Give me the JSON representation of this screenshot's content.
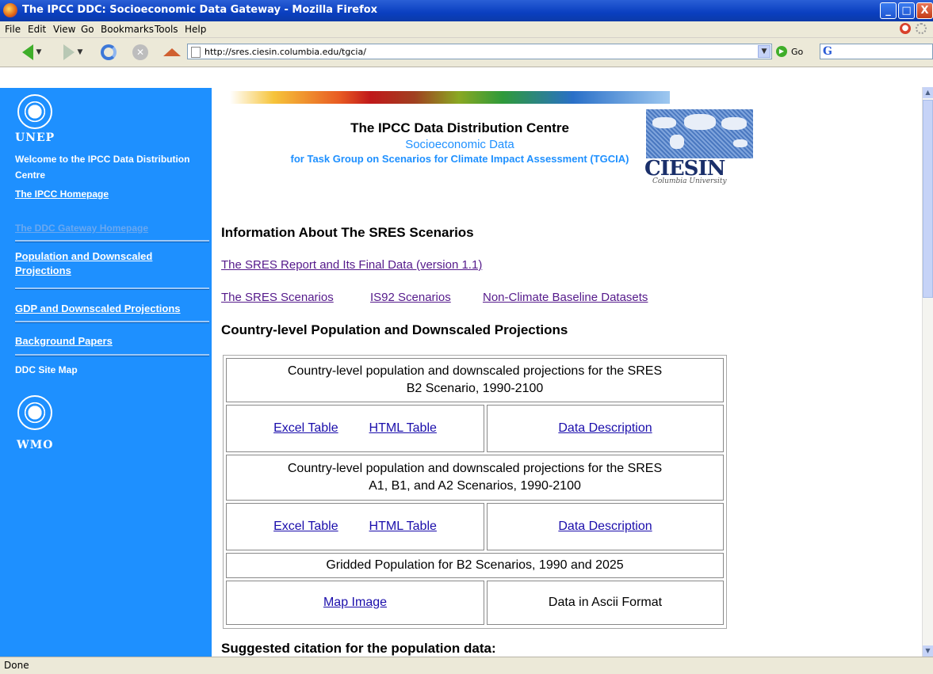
{
  "window": {
    "title": "The IPCC DDC: Socioeconomic Data Gateway - Mozilla Firefox",
    "minimize": "_",
    "maximize": "□",
    "close": "X"
  },
  "menu": [
    "File",
    "Edit",
    "View",
    "Go",
    "Bookmarks",
    "Tools",
    "Help"
  ],
  "toolbar": {
    "url": "http://sres.ciesin.columbia.edu/tgcia/",
    "go_label": "Go",
    "search_icon_letter": "G"
  },
  "sidebar": {
    "unep_label": "UNEP",
    "welcome_line1": "Welcome to the IPCC Data Distribution",
    "welcome_line2": "Centre",
    "ipcc_home": "The IPCC Homepage",
    "ddc_home": "The DDC Gateway Homepage",
    "population_line1": "Population and Downscaled",
    "population_line2": "Projections",
    "gdp": "GDP and Downscaled Projections",
    "background": "Background Papers",
    "site_map": "DDC Site Map",
    "wmo_label": "WMO"
  },
  "header": {
    "title": "The IPCC Data Distribution Centre",
    "subtitle": "Socioeconomic Data",
    "tagline": "for Task Group on Scenarios for Climate Impact Assessment (TGCIA)",
    "logo_text": "CIESIN",
    "logo_sub": "Columbia University"
  },
  "sections": {
    "info_heading": "Information About The SRES Scenarios",
    "sres_report_link": "The SRES Report and Its Final Data (version 1.1)",
    "sres_scenarios_link": "The SRES Scenarios",
    "is92_link": "IS92 Scenarios",
    "baseline_link": "Non-Climate Baseline Datasets",
    "country_heading": "Country-level Population and Downscaled Projections",
    "citation_heading": "Suggested citation for the population data:"
  },
  "table": {
    "b2_title_line1": "Country-level population and downscaled projections for the SRES",
    "b2_title_line2": "B2 Scenario, 1990-2100",
    "a1_title_line1": "Country-level population and downscaled projections for the SRES",
    "a1_title_line2": "A1, B1, and A2 Scenarios, 1990-2100",
    "excel": "Excel Table",
    "html": "HTML Table",
    "desc": "Data Description",
    "gridded_title": "Gridded Population for B2 Scenarios, 1990 and 2025",
    "map_image": "Map Image",
    "ascii": "Data in Ascii Format"
  },
  "status": {
    "text": "Done"
  }
}
